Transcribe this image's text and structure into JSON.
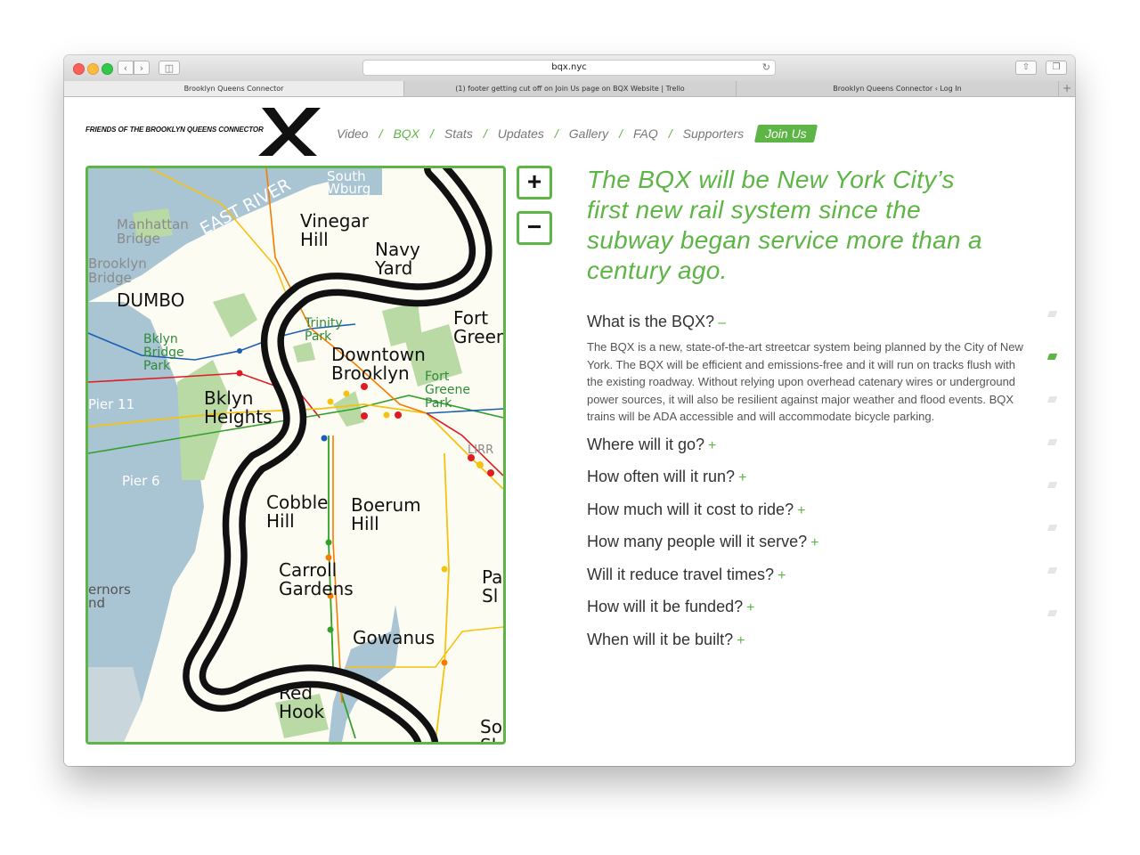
{
  "browser": {
    "url": "bqx.nyc",
    "tabs": [
      {
        "label": "Brooklyn Queens Connector",
        "active": true
      },
      {
        "label": "(1) footer getting cut off on Join Us page on BQX Website | Trello",
        "active": false
      },
      {
        "label": "Brooklyn Queens Connector ‹ Log In",
        "active": false
      }
    ]
  },
  "site": {
    "brand": "FRIENDS OF THE BROOKLYN QUEENS CONNECTOR",
    "accent_color": "#5cb544",
    "nav": [
      {
        "label": "Video",
        "active": false
      },
      {
        "label": "BQX",
        "active": true
      },
      {
        "label": "Stats",
        "active": false
      },
      {
        "label": "Updates",
        "active": false
      },
      {
        "label": "Gallery",
        "active": false
      },
      {
        "label": "FAQ",
        "active": false
      },
      {
        "label": "Supporters",
        "active": false
      }
    ],
    "nav_separator": "/",
    "join_label": "Join Us"
  },
  "map": {
    "zoom_in": "+",
    "zoom_out": "−",
    "labels": {
      "south_wburg": "South\nWburg",
      "east_river": "EAST RIVER",
      "manhattan_bridge": "Manhattan\nBridge",
      "vinegar_hill": "Vinegar\nHill",
      "navy_yard": "Navy\nYard",
      "brooklyn_bridge": "Brooklyn\nBridge",
      "dumbo": "DUMBO",
      "trinity_park": "Trinity\nPark",
      "fort_greene": "Fort\nGreen",
      "bklyn_bridge_park": "Bklyn\nBridge\nPark",
      "downtown_brooklyn": "Downtown\nBrooklyn",
      "fort_greene_park": "Fort\nGreene\nPark",
      "pier_11": "Pier 11",
      "bklyn_heights": "Bklyn\nHeights",
      "lirr": "LIRR",
      "pier_6": "Pier 6",
      "cobble_hill": "Cobble\nHill",
      "boerum_hill": "Boerum\nHill",
      "carroll_gardens": "Carroll\nGardens",
      "park_slope": "Pa\nSl",
      "governors_island": "ernors\nnd",
      "gowanus": "Gowanus",
      "red_hook": "Red\nHook",
      "south_slope": "So\nSl"
    }
  },
  "content": {
    "headline": "The BQX will be New York City’s first new rail system since the subway began service more than a century ago.",
    "faq": [
      {
        "question": "What is the BQX?",
        "sign": "–",
        "open": true,
        "answer": "The BQX is a new, state-of-the-art streetcar system being planned by the City of New York. The BQX will be efficient and emissions-free and it will run on tracks flush with the existing roadway. Without relying upon overhead catenary wires or underground power sources, it will also be resilient against major weather and flood events. BQX trains will be ADA accessible and will accommodate bicycle parking."
      },
      {
        "question": "Where will it go?",
        "sign": "+",
        "open": false
      },
      {
        "question": "How often will it run?",
        "sign": "+",
        "open": false
      },
      {
        "question": "How much will it cost to ride?",
        "sign": "+",
        "open": false
      },
      {
        "question": "How many people will it serve?",
        "sign": "+",
        "open": false
      },
      {
        "question": "Will it reduce travel times?",
        "sign": "+",
        "open": false
      },
      {
        "question": "How will it be funded?",
        "sign": "+",
        "open": false
      },
      {
        "question": "When will it be built?",
        "sign": "+",
        "open": false
      }
    ],
    "section_indicator_count": 8,
    "section_indicator_active": 1
  }
}
